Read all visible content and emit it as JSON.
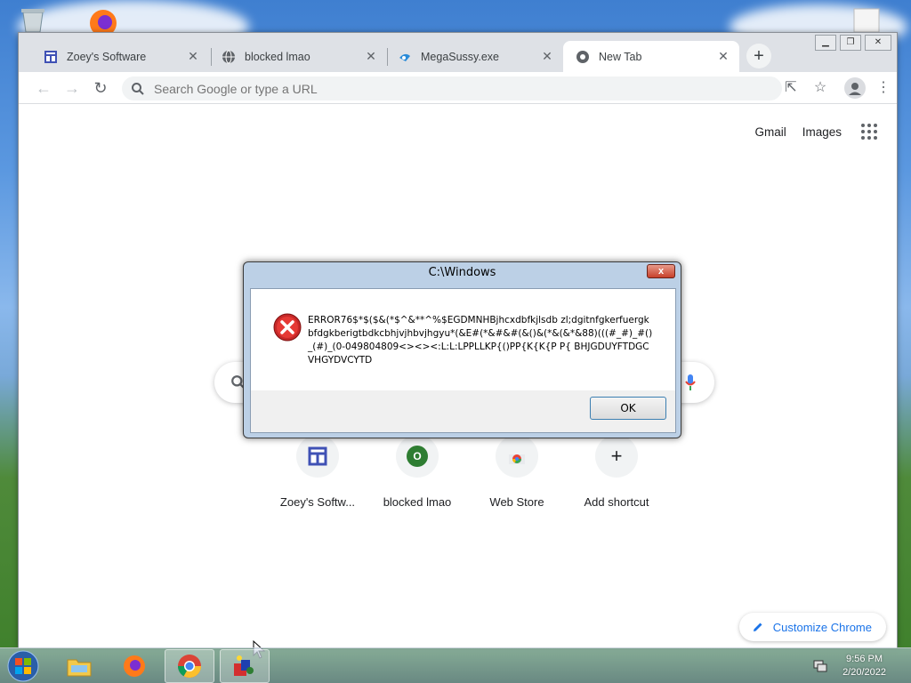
{
  "browser": {
    "tabs": [
      {
        "title": "Zoey's Software",
        "close": "✕"
      },
      {
        "title": "blocked lmao",
        "close": "✕"
      },
      {
        "title": "MegaSussy.exe",
        "close": "✕"
      },
      {
        "title": "New Tab",
        "close": "✕",
        "active": true
      }
    ],
    "new_tab": "+",
    "omnibox_placeholder": "Search Google or type a URL",
    "top_links": {
      "gmail": "Gmail",
      "images": "Images"
    },
    "shortcuts": [
      {
        "label": "Zoey's Softw...",
        "letter": ""
      },
      {
        "label": "blocked lmao",
        "letter": "O"
      },
      {
        "label": "Web Store",
        "letter": ""
      },
      {
        "label": "Add shortcut",
        "letter": "+"
      }
    ],
    "customize_label": "Customize Chrome"
  },
  "dialog": {
    "title": "C:\\Windows",
    "close": "x",
    "message": "ERROR76$*$($&(*$^&**^%$EGDMNHBjhcxdbfkjlsdb zl;dgitnfgkerfuergkbfdgkberigtbdkcbhjvjhbvjhgyu*(&E#(*&#&#(&()&(*&(&*&88)(((#_#)_#()_(#)_(0-049804809<><><:L:L:LPPLLKP{()PP{K{K{P P{ BHJGDUYFTDGCVHGYDVCYTD",
    "ok_label": "OK"
  },
  "taskbar": {
    "time": "9:56 PM",
    "date": "2/20/2022"
  },
  "colors": {
    "accent": "#1a73e8",
    "error_red": "#c62828",
    "shortcut_green": "#2e7d32",
    "shortcut_navy": "#3f51b5"
  }
}
